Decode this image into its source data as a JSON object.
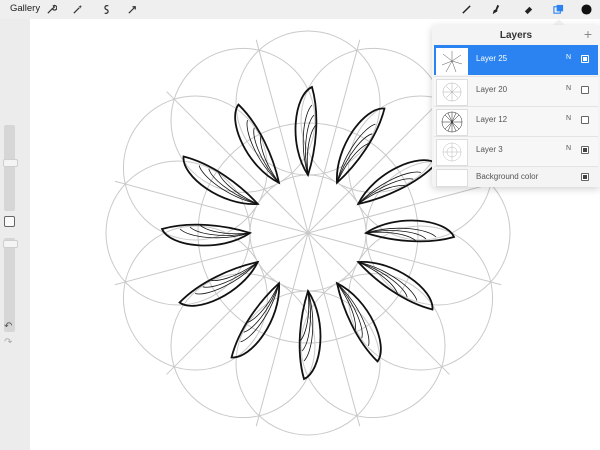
{
  "topbar": {
    "gallery_label": "Gallery"
  },
  "tools_right": {
    "brush": "brush-icon",
    "smudge": "smudge-icon",
    "eraser": "eraser-icon",
    "layers": "layers-icon",
    "color": "#111111",
    "layers_active_color": "#2a83f0"
  },
  "tools_left": [
    "wrench-icon",
    "magic-wand-icon",
    "selection-icon",
    "transform-icon"
  ],
  "layers_panel": {
    "title": "Layers",
    "add_label": "+",
    "layers": [
      {
        "name": "Layer 25",
        "mode": "N",
        "visible": true,
        "active": true
      },
      {
        "name": "Layer 20",
        "mode": "N",
        "visible": false,
        "active": false
      },
      {
        "name": "Layer 12",
        "mode": "N",
        "visible": false,
        "active": false
      },
      {
        "name": "Layer 3",
        "mode": "N",
        "visible": true,
        "active": false
      }
    ],
    "background": {
      "name": "Background color",
      "visible": true
    }
  },
  "sidebar": {
    "undo_label": "↶",
    "redo_label": "↷"
  }
}
